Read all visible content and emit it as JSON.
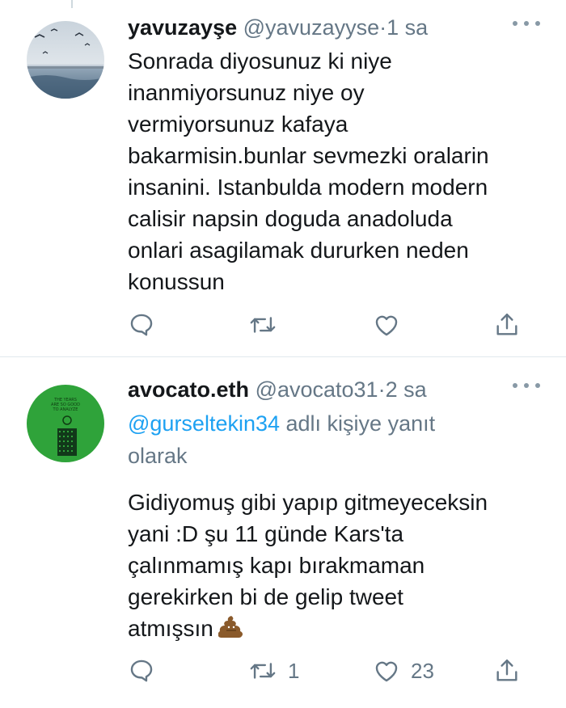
{
  "tweets": [
    {
      "name": "yavuzayşe",
      "handle": "@yavuzayyse",
      "separator": "·",
      "time": "1 sa",
      "lines": [
        "Sonrada diyosunuz ki niye",
        "inanmiyorsunuz niye oy",
        "vermiyorsunuz kafaya",
        "bakarmisin.bunlar sevmezki oralarin",
        "insanini. Istanbulda modern modern",
        "calisir napsin doguda anadoluda",
        "onlari asagilamak dururken neden",
        "konussun"
      ],
      "reply_count": "",
      "retweet_count": "",
      "like_count": ""
    },
    {
      "name": "avocato.eth",
      "handle": "@avocato31",
      "separator": "·",
      "time": "2 sa",
      "reply_to_mention": "@gurseltekin34",
      "reply_to_suffix": " adlı kişiye yanıt",
      "reply_to_line2": "olarak",
      "lines": [
        "Gidiyomuş gibi yapıp gitmeyeceksin",
        "yani :D şu 11 günde Kars'ta",
        "çalınmamış kapı bırakmaman",
        "gerekirken bi de gelip tweet",
        "atmışsın"
      ],
      "emoji": "pile-of-poo-icon",
      "reply_count": "",
      "retweet_count": "1",
      "like_count": "23"
    }
  ],
  "colors": {
    "link": "#1da1f2",
    "muted": "#657786",
    "avatar2_bg": "#2fa33a"
  }
}
